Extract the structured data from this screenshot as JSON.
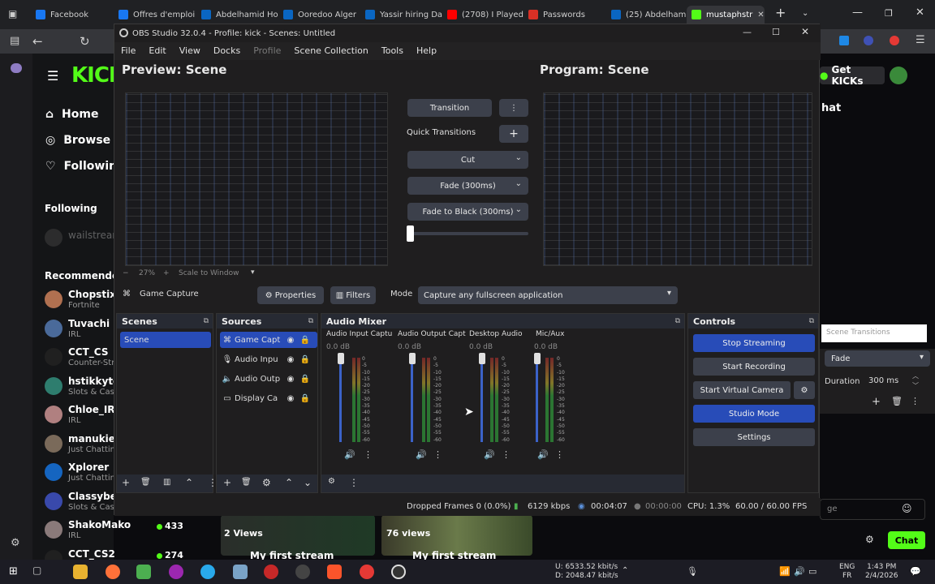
{
  "browser": {
    "tabs": [
      {
        "label": "Facebook",
        "color": "#1877f2"
      },
      {
        "label": "Offres d'emploi",
        "color": "#1877f2"
      },
      {
        "label": "Abdelhamid Ho",
        "color": "#0a66c2"
      },
      {
        "label": "Ooredoo Alger",
        "color": "#0a66c2"
      },
      {
        "label": "Yassir hiring Da",
        "color": "#0a66c2"
      },
      {
        "label": "(2708) I Played",
        "color": "#ff0000"
      },
      {
        "label": "Passwords",
        "color": "#d93025"
      },
      {
        "label": "(25) Abdelhami",
        "color": "#0a66c2"
      },
      {
        "label": "mustaphstr",
        "color": "#53fc18"
      }
    ],
    "new_tab": "+",
    "close_tab": "✕"
  },
  "kick": {
    "logo": "KICK",
    "nav": [
      {
        "label": "Home",
        "icon": "home-icon"
      },
      {
        "label": "Browse",
        "icon": "compass-icon"
      },
      {
        "label": "Following",
        "icon": "heart-icon"
      }
    ],
    "following_heading": "Following",
    "following_user": "wailstream",
    "recommended_heading": "Recommended",
    "channels": [
      {
        "name": "Chopstix",
        "category": "Fortnite",
        "color": "#b07050"
      },
      {
        "name": "Tuvachi",
        "category": "IRL",
        "color": "#4a6a9a"
      },
      {
        "name": "CCT_CS",
        "category": "Counter-Str",
        "color": "#202020"
      },
      {
        "name": "hstikkytok",
        "category": "Slots & Casi",
        "color": "#2e7d6e"
      },
      {
        "name": "Chloe_IRL",
        "category": "IRL",
        "color": "#b08080"
      },
      {
        "name": "manukiem",
        "category": "Just Chattin",
        "color": "#7a6a5a"
      },
      {
        "name": "Xplorer",
        "category": "Just Chattin",
        "color": "#1565c0"
      },
      {
        "name": "Classybee",
        "category": "Slots & Casi",
        "color": "#3949ab"
      },
      {
        "name": "ShakoMako",
        "category": "IRL",
        "color": "#8a7a7a",
        "viewers": "433"
      },
      {
        "name": "CCT_CS2",
        "category": "",
        "color": "#202020",
        "viewers": "274"
      }
    ],
    "get_kicks": "Get KICKs",
    "chat_heading": "hat",
    "chat_placeholder": "ge",
    "chat_button": "Chat",
    "thumb1_views": "2 Views",
    "thumb2_views": "76 views",
    "thumb1_title": "My first stream",
    "thumb2_title": "My first stream"
  },
  "obs": {
    "title": "OBS Studio 32.0.4 - Profile: kick - Scenes: Untitled",
    "menu": [
      "File",
      "Edit",
      "View",
      "Docks",
      "Profile",
      "Scene Collection",
      "Tools",
      "Help"
    ],
    "preview_heading": "Preview: Scene",
    "program_heading": "Program: Scene",
    "transition_button": "Transition",
    "quick_transitions": "Quick Transitions",
    "quick_list": [
      "Cut",
      "Fade (300ms)",
      "Fade to Black (300ms)"
    ],
    "zoom_level": "27%",
    "scale_mode": "Scale to Window",
    "source_bar": {
      "source": "Game Capture",
      "properties": "Properties",
      "filters": "Filters",
      "mode_label": "Mode",
      "mode_value": "Capture any fullscreen application"
    },
    "scenes": {
      "title": "Scenes",
      "items": [
        "Scene"
      ]
    },
    "sources": {
      "title": "Sources",
      "items": [
        "Game Capt",
        "Audio Inpu",
        "Audio Outp",
        "Display Ca"
      ]
    },
    "mixer": {
      "title": "Audio Mixer",
      "channels": [
        {
          "name": "Audio Input Captu",
          "db": "0.0 dB"
        },
        {
          "name": "Audio Output Capt",
          "db": "0.0 dB"
        },
        {
          "name": "Desktop Audio",
          "db": "0.0 dB"
        },
        {
          "name": "Mic/Aux",
          "db": "0.0 dB"
        }
      ],
      "scale": [
        "0",
        "-5",
        "-10",
        "-15",
        "-20",
        "-25",
        "-30",
        "-35",
        "-40",
        "-45",
        "-50",
        "-55",
        "-60"
      ]
    },
    "controls": {
      "title": "Controls",
      "buttons": [
        "Stop Streaming",
        "Start Recording",
        "Start Virtual Camera",
        "Studio Mode",
        "Settings"
      ]
    },
    "status": {
      "dropped": "Dropped Frames 0 (0.0%)",
      "bitrate": "6129 kbps",
      "stream_time": "00:04:07",
      "rec_time": "00:00:00",
      "cpu": "CPU: 1.3%",
      "fps": "60.00 / 60.00 FPS"
    }
  },
  "scene_transitions": {
    "title": "Scene Transitions",
    "type": "Fade",
    "duration_label": "Duration",
    "duration_value": "300 ms"
  },
  "taskbar": {
    "net_up": "U:   6533.52 kbit/s",
    "net_down": "D:   2048.47 kbit/s",
    "lang": "ENG",
    "region": "FR",
    "time": "1:43 PM",
    "date": "2/4/2026"
  }
}
